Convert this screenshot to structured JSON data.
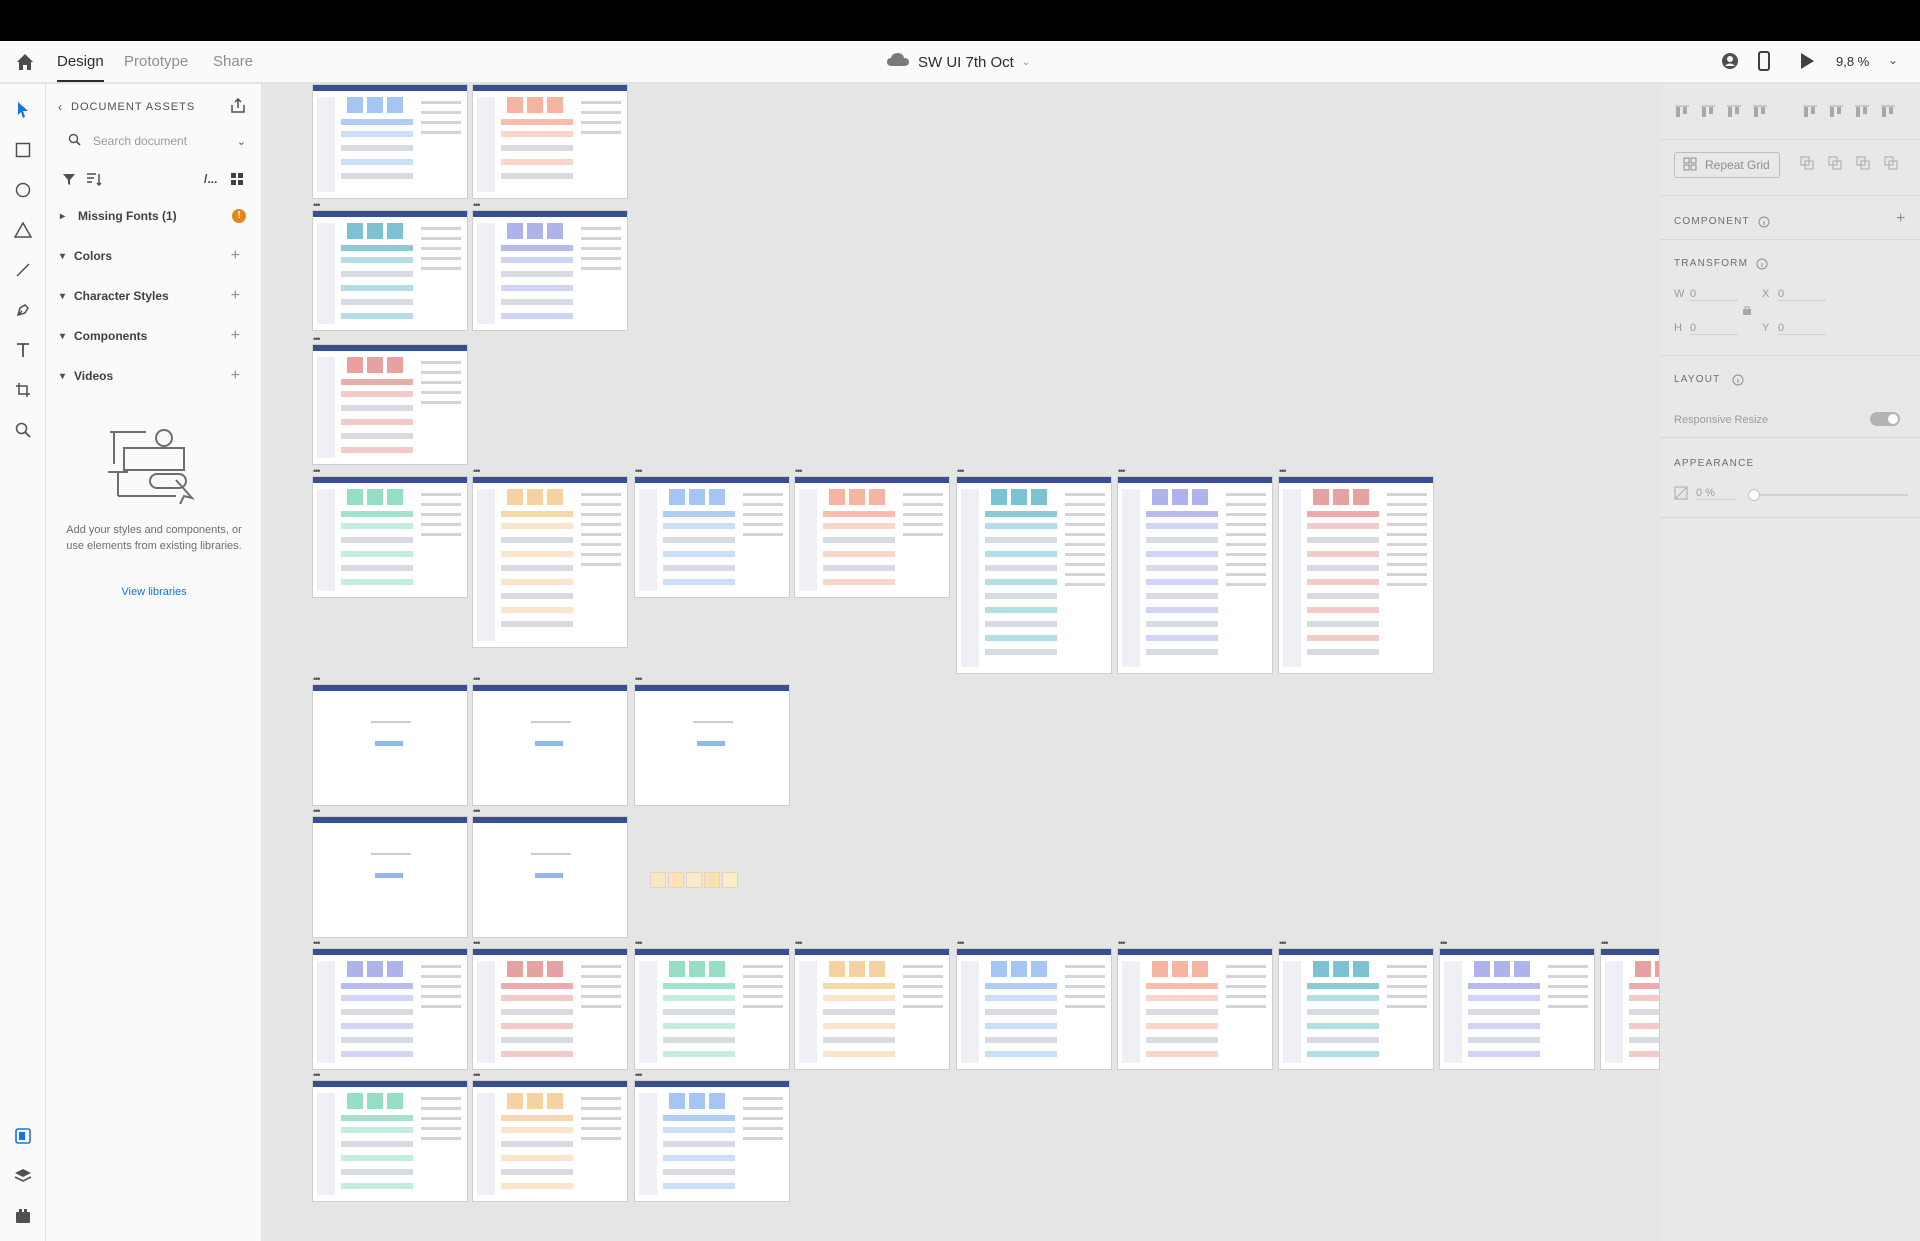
{
  "app": {
    "tabs": [
      {
        "label": "Design",
        "active": true
      },
      {
        "label": "Prototype",
        "active": false
      },
      {
        "label": "Share",
        "active": false
      }
    ],
    "document_title": "SW UI 7th Oct",
    "zoom": "9,8 %"
  },
  "assets": {
    "header": "DOCUMENT ASSETS",
    "search_placeholder": "Search document",
    "sort_label": "/...",
    "missing_fonts": "Missing Fonts (1)",
    "sections": [
      {
        "label": "Colors"
      },
      {
        "label": "Character Styles"
      },
      {
        "label": "Components"
      },
      {
        "label": "Videos"
      }
    ],
    "empty_text": "Add your styles and components, or use elements from existing libraries.",
    "view_libraries": "View libraries"
  },
  "props": {
    "repeat_grid": "Repeat Grid",
    "component": "COMPONENT",
    "transform": "TRANSFORM",
    "w_label": "W",
    "w_value": "0",
    "x_label": "X",
    "x_value": "0",
    "h_label": "H",
    "h_value": "0",
    "y_label": "Y",
    "y_value": "0",
    "layout": "LAYOUT",
    "responsive_resize": "Responsive Resize",
    "appearance": "APPEARANCE",
    "opacity": "0 %"
  },
  "colors": {
    "accent": "#1473e6",
    "header_bar": "#3c4e93",
    "warning": "#e68619"
  }
}
